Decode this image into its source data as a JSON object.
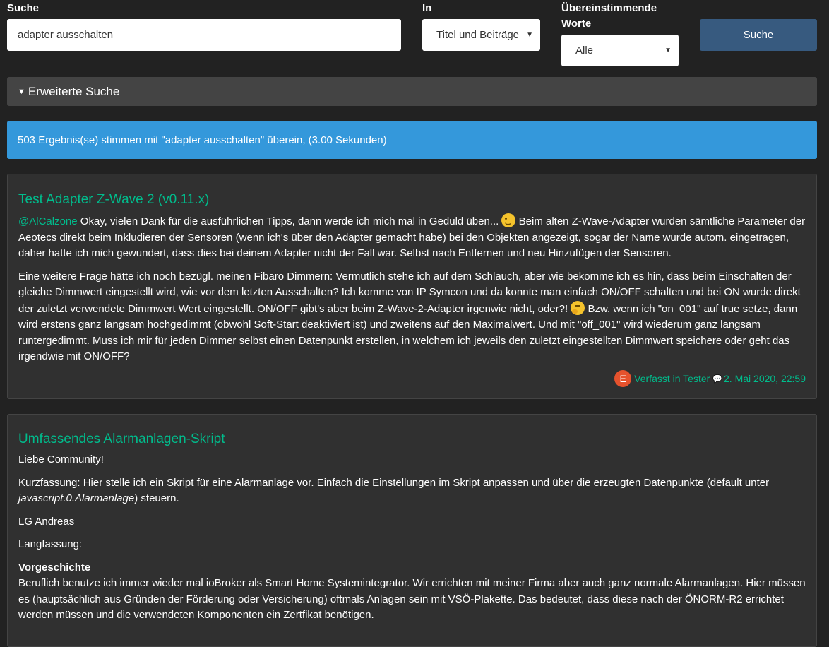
{
  "search": {
    "label": "Suche",
    "value": "adapter ausschalten",
    "in_label": "In",
    "in_value": "Titel und Beiträge",
    "match_label_line1": "Übereinstimmende",
    "match_label_line2": "Worte",
    "match_value": "Alle",
    "button": "Suche",
    "advanced": "Erweiterte Suche"
  },
  "result_summary": "503 Ergebnis(se) stimmen mit \"adapter ausschalten\" überein, (3.00 Sekunden)",
  "results": [
    {
      "title": "Test Adapter Z-Wave 2 (v0.11.x)",
      "mention": "@AlCalzone",
      "p1_a": " Okay, vielen Dank für die ausführlichen Tipps, dann werde ich mich mal in Geduld üben... ",
      "p1_b": " Beim alten Z-Wave-Adapter wurden sämtliche Parameter der Aeotecs direkt beim Inkludieren der Sensoren (wenn ich's über den Adapter gemacht habe) bei den Objekten angezeigt, sogar der Name wurde autom. eingetragen, daher hatte ich mich gewundert, dass dies bei deinem Adapter nicht der Fall war. Selbst nach Entfernen und neu Hinzufügen der Sensoren.",
      "p2_a": "Eine weitere Frage hätte ich noch bezügl. meinen Fibaro Dimmern: Vermutlich stehe ich auf dem Schlauch, aber wie bekomme ich es hin, dass beim Einschalten der gleiche Dimmwert eingestellt wird, wie vor dem letzten Ausschalten? Ich komme von IP Symcon und da konnte man einfach ON/OFF schalten und bei ON wurde direkt der zuletzt verwendete Dimmwert Wert eingestellt. ON/OFF gibt's aber beim Z-Wave-2-Adapter irgenwie nicht, oder?! ",
      "p2_b": " Bzw. wenn ich \"on_001\" auf true setze, dann wird erstens ganz langsam hochgedimmt (obwohl Soft-Start deaktiviert ist) und zweitens auf den Maximalwert. Und mit \"off_001\" wird wiederum ganz langsam runtergedimmt. Muss ich mir für jeden Dimmer selbst einen Datenpunkt erstellen, in welchem ich jeweils den zuletzt eingestellten Dimmwert speichere oder geht das irgendwie mit ON/OFF?",
      "avatar_letter": "E",
      "author": "Verfasst in Tester",
      "date": "2. Mai 2020, 22:59"
    },
    {
      "title": "Umfassendes Alarmanlagen-Skript",
      "p1": "Liebe Community!",
      "p2_a": "Kurzfassung: Hier stelle ich ein Skript für eine Alarmanlage vor. Einfach die Einstellungen im Skript anpassen und über die erzeugten Datenpunkte (default unter ",
      "p2_em": "javascript.0.Alarmanlage",
      "p2_b": ") steuern.",
      "p3": "LG Andreas",
      "p4": "Langfassung:",
      "p5_heading": "Vorgeschichte",
      "p5": "Beruflich benutze ich immer wieder mal ioBroker als Smart Home Systemintegrator. Wir errichten mit meiner Firma aber auch ganz normale Alarmanlagen. Hier müssen es (hauptsächlich aus Gründen der Förderung oder Versicherung) oftmals Anlagen sein mit VSÖ-Plakette. Das bedeutet, dass diese nach der ÖNORM-R2 errichtet werden müssen und die verwendeten Komponenten ein Zertfikat benötigen."
    }
  ],
  "colors": {
    "background": "#222222",
    "card": "#303030",
    "accent": "#00bc8c",
    "info": "#3498db",
    "primary": "#375a7f"
  }
}
